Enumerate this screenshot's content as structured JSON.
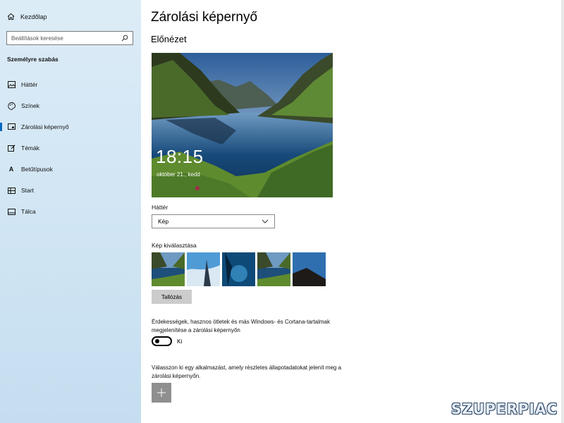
{
  "sidebar": {
    "home_label": "Kezdőlap",
    "search_placeholder": "Beállítások keresése",
    "section_title": "Személyre szabás",
    "items": [
      {
        "label": "Háttér",
        "icon": "image-icon"
      },
      {
        "label": "Színek",
        "icon": "palette-icon"
      },
      {
        "label": "Zárolási képernyő",
        "icon": "lock-screen-icon"
      },
      {
        "label": "Témák",
        "icon": "brush-icon"
      },
      {
        "label": "Betűtípusok",
        "icon": "font-icon"
      },
      {
        "label": "Start",
        "icon": "start-icon"
      },
      {
        "label": "Tálca",
        "icon": "taskbar-icon"
      }
    ],
    "active_item": "Zárolási képernyő"
  },
  "main": {
    "title": "Zárolási képernyő",
    "preview_heading": "Előnézet",
    "preview": {
      "time": "18:15",
      "date": "október 21., kedd"
    },
    "background_label": "Háttér",
    "background_value": "Kép",
    "choose_picture_label": "Kép kiválasztása",
    "browse_button": "Tallózás",
    "tips_text": "Érdekességek, hasznos ötletek és más Windows- és Cortana-tartalmak megjelenítése a zárolási képernyőn",
    "toggle_state": "Ki",
    "detailed_status_text": "Válasszon ki egy alkalmazást, amely részletes állapotadatokat jelenít meg a zárolási képernyőn."
  },
  "watermark": "SZUPERPIAC",
  "colors": {
    "accent": "#0067c0",
    "sidebar_bg": "#d4e7f5",
    "button_gray": "#cccccc"
  }
}
